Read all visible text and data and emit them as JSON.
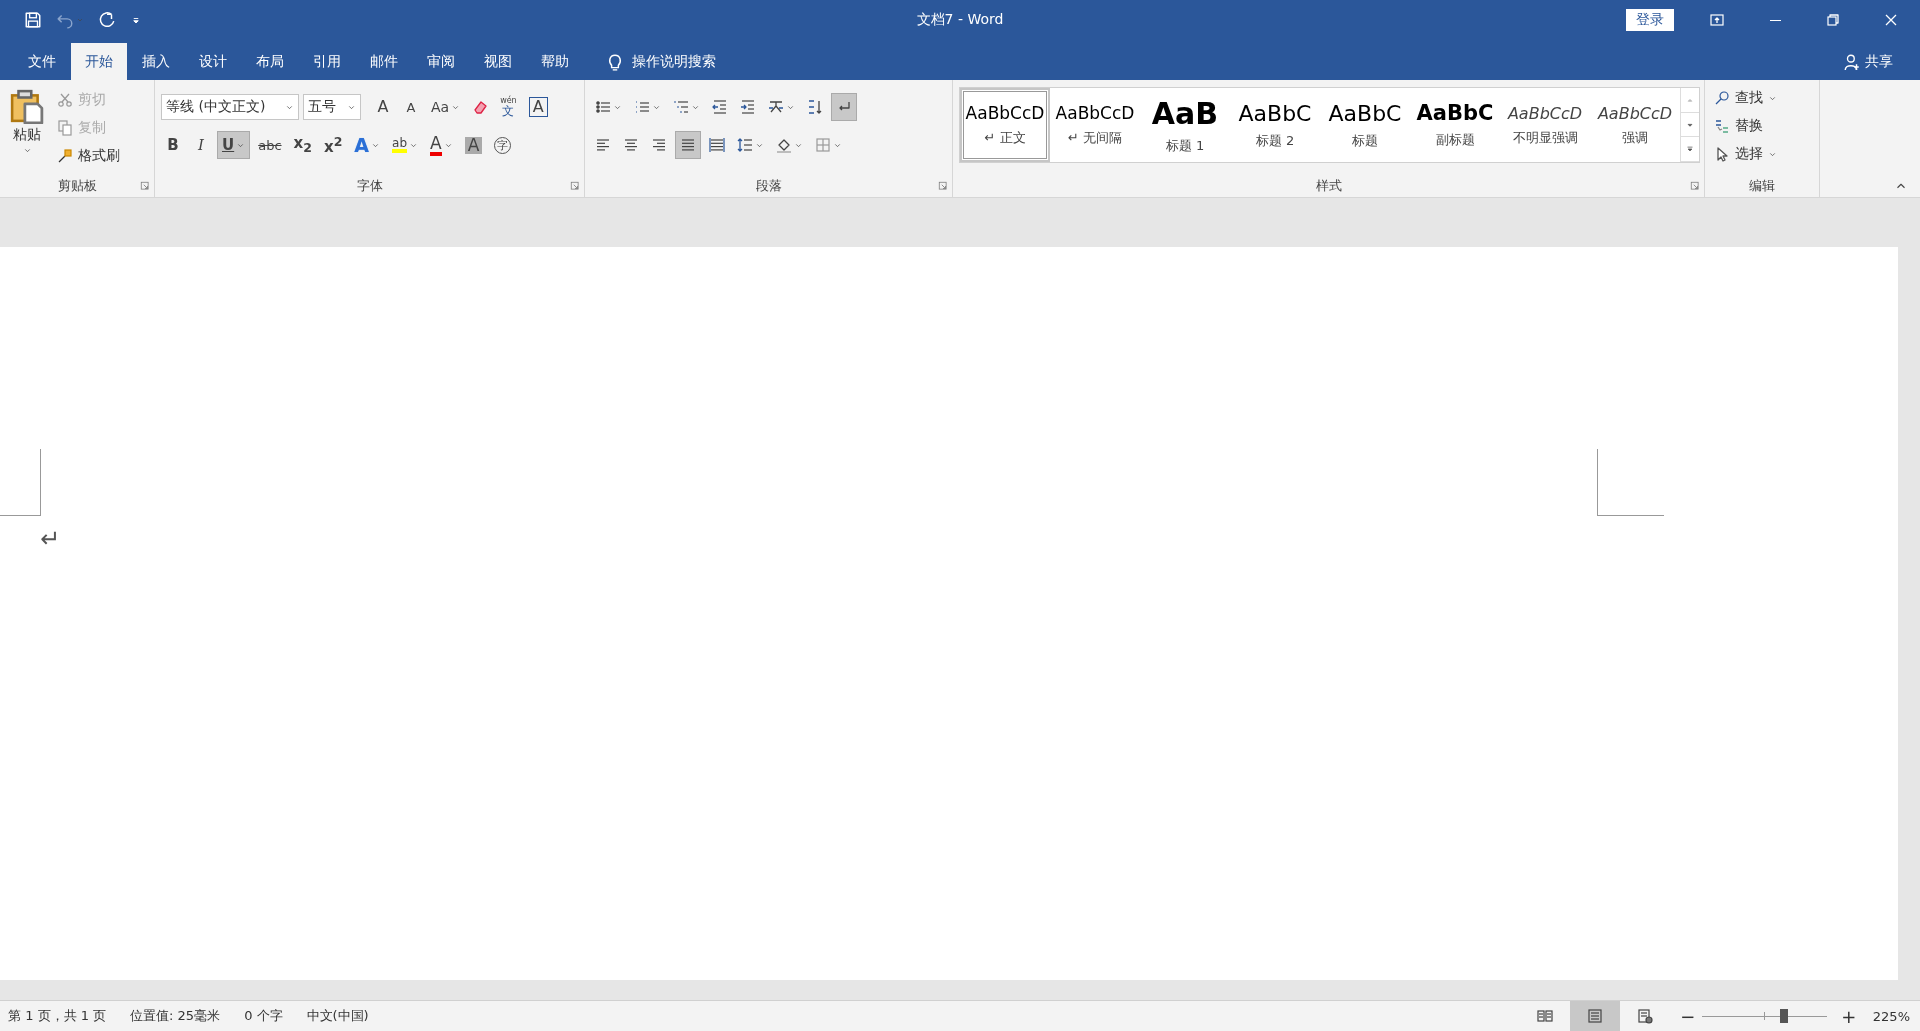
{
  "window": {
    "title": "文档7 - Word",
    "login": "登录"
  },
  "tabs": [
    {
      "label": "文件",
      "selected": false
    },
    {
      "label": "开始",
      "selected": true
    },
    {
      "label": "插入",
      "selected": false
    },
    {
      "label": "设计",
      "selected": false
    },
    {
      "label": "布局",
      "selected": false
    },
    {
      "label": "引用",
      "selected": false
    },
    {
      "label": "邮件",
      "selected": false
    },
    {
      "label": "审阅",
      "selected": false
    },
    {
      "label": "视图",
      "selected": false
    },
    {
      "label": "帮助",
      "selected": false
    }
  ],
  "tell_me": "操作说明搜索",
  "share": "共享",
  "clipboard": {
    "title": "剪贴板",
    "paste": "粘贴",
    "items": [
      {
        "kind": "cut",
        "label": "剪切",
        "disabled": true
      },
      {
        "kind": "copy",
        "label": "复制",
        "disabled": true
      },
      {
        "kind": "format-painter",
        "label": "格式刷",
        "disabled": false
      }
    ]
  },
  "font": {
    "title": "字体",
    "name": "等线 (中文正文)",
    "size": "五号",
    "row1": [
      {
        "kind": "grow-font",
        "text": "A",
        "dropdown": false,
        "selected": false
      },
      {
        "kind": "shrink-font",
        "text": "A",
        "dropdown": false,
        "selected": false
      },
      {
        "kind": "change-case",
        "text": "Aa",
        "dropdown": true,
        "selected": false
      },
      {
        "kind": "clear-formatting",
        "dropdown": false,
        "selected": false
      },
      {
        "kind": "phonetic-guide",
        "ruby": "wén",
        "text": "文",
        "dropdown": false,
        "selected": false
      },
      {
        "kind": "character-border",
        "text": "A",
        "dropdown": false,
        "selected": false
      }
    ],
    "row2": [
      {
        "kind": "bold",
        "text": "B",
        "dropdown": false,
        "selected": false
      },
      {
        "kind": "italic",
        "text": "I",
        "dropdown": false,
        "selected": false
      },
      {
        "kind": "underline",
        "text": "U",
        "dropdown": true,
        "selected": true
      },
      {
        "kind": "strikethrough",
        "text": "abc",
        "dropdown": false,
        "selected": false
      },
      {
        "kind": "subscript",
        "text": "x$_{2}$",
        "dropdown": false,
        "selected": false
      },
      {
        "kind": "superscript",
        "text": "x$^{2}$",
        "dropdown": false,
        "selected": false
      },
      {
        "kind": "text-effects",
        "text": "A",
        "dropdown": true,
        "selected": false
      },
      {
        "kind": "highlight",
        "text": "ab",
        "dropdown": true,
        "selected": false
      },
      {
        "kind": "font-color",
        "text": "A",
        "dropdown": true,
        "selected": false
      },
      {
        "kind": "character-shading",
        "text": "A",
        "dropdown": false,
        "selected": false
      },
      {
        "kind": "enclosed-character",
        "text": "字",
        "dropdown": false,
        "selected": false
      }
    ]
  },
  "paragraph": {
    "title": "段落",
    "row1": [
      {
        "kind": "bullets",
        "dropdown": true,
        "selected": false
      },
      {
        "kind": "numbering",
        "dropdown": true,
        "selected": false
      },
      {
        "kind": "multilevel-list",
        "dropdown": true,
        "selected": false
      },
      {
        "kind": "decrease-indent",
        "dropdown": false,
        "selected": false
      },
      {
        "kind": "increase-indent",
        "dropdown": false,
        "selected": false
      },
      {
        "kind": "asian-layout",
        "dropdown": true,
        "selected": false
      },
      {
        "kind": "sort",
        "dropdown": false,
        "selected": false
      },
      {
        "kind": "show-marks",
        "dropdown": false,
        "selected": true
      }
    ],
    "row2": [
      {
        "kind": "align-left",
        "dropdown": false,
        "selected": false
      },
      {
        "kind": "center",
        "dropdown": false,
        "selected": false
      },
      {
        "kind": "align-right",
        "dropdown": false,
        "selected": false
      },
      {
        "kind": "justify",
        "dropdown": false,
        "selected": true
      },
      {
        "kind": "distributed",
        "dropdown": false,
        "selected": false
      },
      {
        "kind": "line-spacing",
        "dropdown": true,
        "selected": false
      },
      {
        "kind": "shading",
        "dropdown": true,
        "selected": false
      },
      {
        "kind": "borders",
        "dropdown": true,
        "selected": false
      }
    ]
  },
  "styles": {
    "title": "样式",
    "items": [
      {
        "kind": "normal",
        "preview": "AaBbCcD",
        "label": "↵ 正文",
        "selected": true
      },
      {
        "kind": "no-spacing",
        "preview": "AaBbCcD",
        "label": "↵ 无间隔",
        "selected": false
      },
      {
        "kind": "heading1",
        "preview": "AaB",
        "label": "标题 1",
        "selected": false
      },
      {
        "kind": "heading2",
        "preview": "AaBbC",
        "label": "标题 2",
        "selected": false
      },
      {
        "kind": "title",
        "preview": "AaBbC",
        "label": "标题",
        "selected": false
      },
      {
        "kind": "subtitle",
        "preview": "AaBbC",
        "label": "副标题",
        "selected": false
      },
      {
        "kind": "subtle-emphasis",
        "preview": "AaBbCcD",
        "label": "不明显强调",
        "selected": false
      },
      {
        "kind": "emphasis",
        "preview": "AaBbCcD",
        "label": "强调",
        "selected": false
      }
    ]
  },
  "editing": {
    "title": "编辑",
    "items": [
      {
        "kind": "find",
        "label": "查找",
        "dropdown": true
      },
      {
        "kind": "replace",
        "label": "替换",
        "dropdown": false
      },
      {
        "kind": "select",
        "label": "选择",
        "dropdown": true
      }
    ]
  },
  "document": {
    "paragraph_mark": "↵"
  },
  "status_bar": {
    "items": [
      "第 1 页，共 1 页",
      "位置值: 25毫米",
      "0 个字",
      "中文(中国)"
    ],
    "views": [
      {
        "kind": "read",
        "selected": false
      },
      {
        "kind": "print",
        "selected": true
      },
      {
        "kind": "web",
        "selected": false
      }
    ],
    "zoom_out": "−",
    "zoom_in": "+",
    "zoom": {
      "level": 0.66
    },
    "zoom_percent": "225%"
  }
}
